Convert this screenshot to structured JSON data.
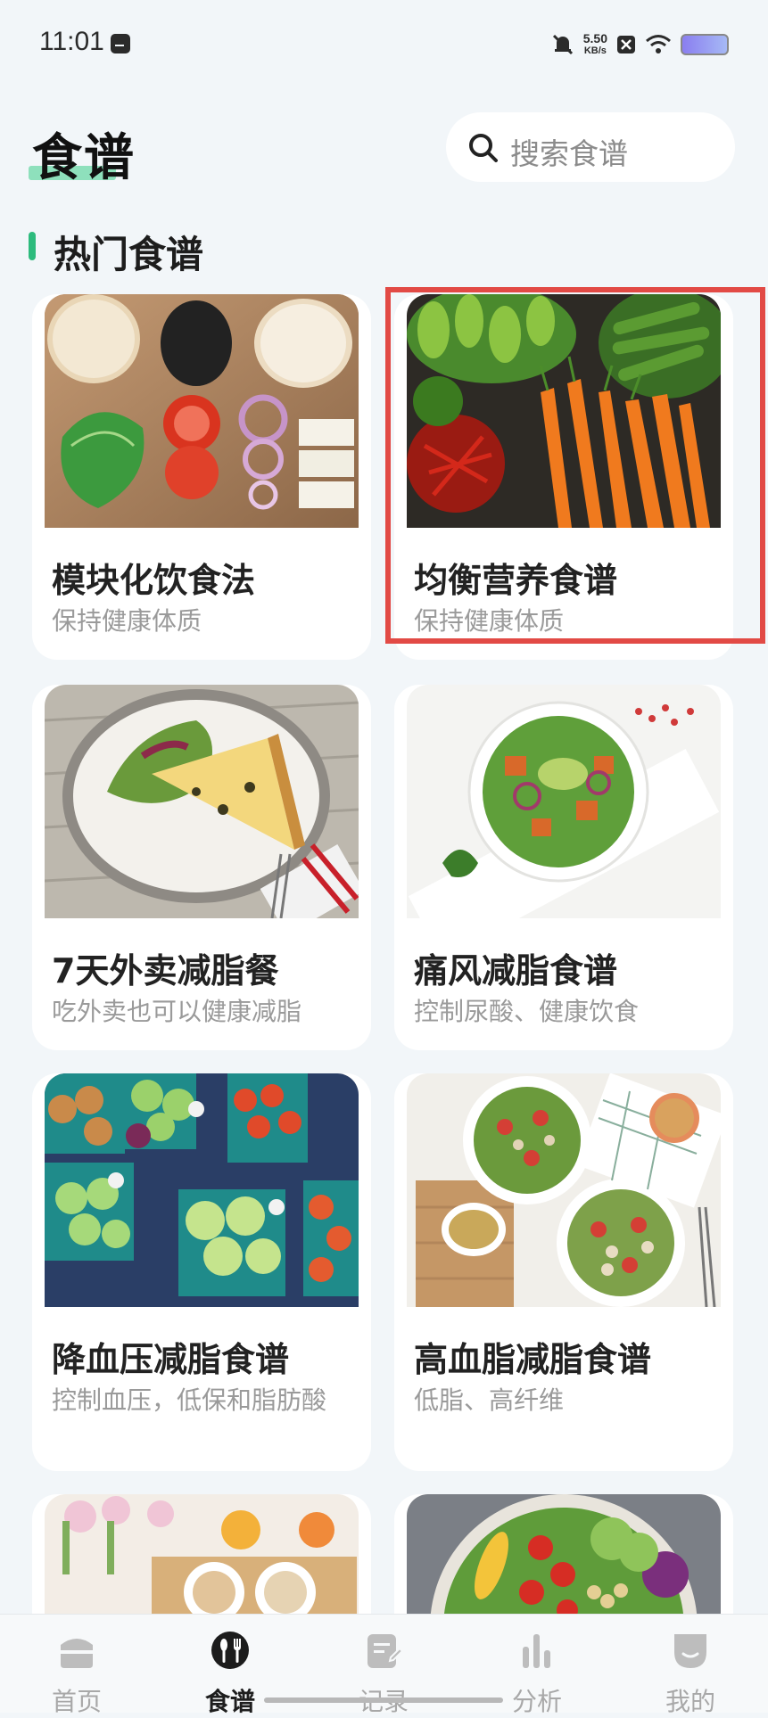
{
  "status_bar": {
    "time": "11:01",
    "speed_value": "5.50",
    "speed_unit": "KB/s"
  },
  "header": {
    "title": "食谱",
    "search_placeholder": "搜索食谱"
  },
  "section": {
    "title": "热门食谱"
  },
  "recipes": [
    {
      "title": "模块化饮食法",
      "subtitle": "保持健康体质"
    },
    {
      "title": "均衡营养食谱",
      "subtitle": "保持健康体质"
    },
    {
      "title": "7天外卖减脂餐",
      "subtitle": "吃外卖也可以健康减脂"
    },
    {
      "title": "痛风减脂食谱",
      "subtitle": "控制尿酸、健康饮食"
    },
    {
      "title": "降血压减脂食谱",
      "subtitle": "控制血压，低保和脂肪酸"
    },
    {
      "title": "高血脂减脂食谱",
      "subtitle": "低脂、高纤维"
    }
  ],
  "nav": {
    "items": [
      {
        "label": "首页",
        "icon": "home-icon"
      },
      {
        "label": "食谱",
        "icon": "recipe-icon"
      },
      {
        "label": "记录",
        "icon": "record-icon"
      },
      {
        "label": "分析",
        "icon": "analysis-icon"
      },
      {
        "label": "我的",
        "icon": "profile-icon"
      }
    ],
    "active": "食谱"
  },
  "colors": {
    "accent": "#2dbb7d",
    "highlight": "#e24a45"
  }
}
